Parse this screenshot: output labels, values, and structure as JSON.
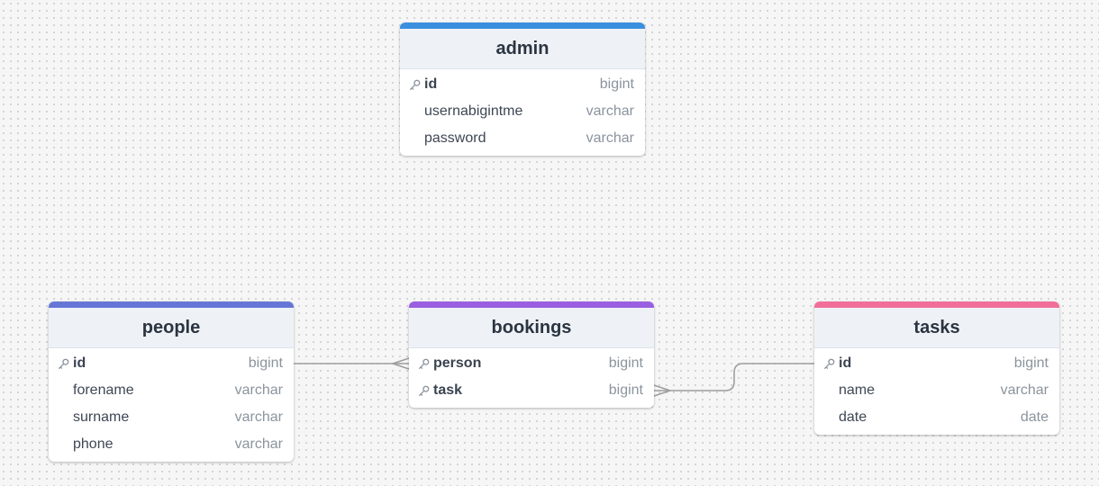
{
  "diagram": {
    "tables": [
      {
        "id": "admin",
        "name": "admin",
        "color": "#3b8fde",
        "columns": [
          {
            "name": "id",
            "type": "bigint",
            "key": true
          },
          {
            "name": "usernabigintme",
            "type": "varchar",
            "key": false
          },
          {
            "name": "password",
            "type": "varchar",
            "key": false
          }
        ]
      },
      {
        "id": "people",
        "name": "people",
        "color": "#6676d6",
        "columns": [
          {
            "name": "id",
            "type": "bigint",
            "key": true
          },
          {
            "name": "forename",
            "type": "varchar",
            "key": false
          },
          {
            "name": "surname",
            "type": "varchar",
            "key": false
          },
          {
            "name": "phone",
            "type": "varchar",
            "key": false
          }
        ]
      },
      {
        "id": "bookings",
        "name": "bookings",
        "color": "#9a5ee0",
        "columns": [
          {
            "name": "person",
            "type": "bigint",
            "key": true
          },
          {
            "name": "task",
            "type": "bigint",
            "key": true
          }
        ]
      },
      {
        "id": "tasks",
        "name": "tasks",
        "color": "#f26e99",
        "columns": [
          {
            "name": "id",
            "type": "bigint",
            "key": true
          },
          {
            "name": "name",
            "type": "varchar",
            "key": false
          },
          {
            "name": "date",
            "type": "date",
            "key": false
          }
        ]
      }
    ],
    "relations": [
      {
        "from": "people.id",
        "to": "bookings.person",
        "cardinality": "one-to-many"
      },
      {
        "from": "tasks.id",
        "to": "bookings.task",
        "cardinality": "one-to-many"
      }
    ],
    "edge_color": "#9e9e9e",
    "key_icon": "key-icon"
  }
}
